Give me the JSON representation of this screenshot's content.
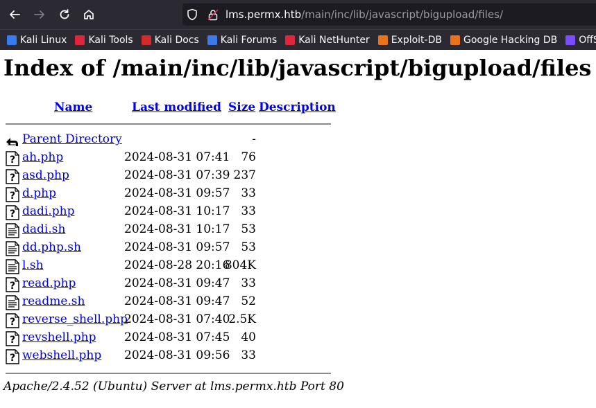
{
  "browser": {
    "url_host": "lms.permx.htb",
    "url_path": "/main/inc/lib/javascript/bigupload/files/",
    "nav_icons": [
      "back-arrow-icon",
      "forward-arrow-icon",
      "reload-icon",
      "home-icon"
    ],
    "bookmarks": [
      {
        "label": "Kali Linux",
        "color": "#367bf0"
      },
      {
        "label": "Kali Tools",
        "color": "#e0263b"
      },
      {
        "label": "Kali Docs",
        "color": "#d12b2b"
      },
      {
        "label": "Kali Forums",
        "color": "#3d7ae6"
      },
      {
        "label": "Kali NetHunter",
        "color": "#e0263b"
      },
      {
        "label": "Exploit-DB",
        "color": "#e8731a"
      },
      {
        "label": "Google Hacking DB",
        "color": "#e8731a"
      },
      {
        "label": "OffSec",
        "color": "#7c4dff"
      }
    ]
  },
  "page": {
    "title": "Index of /main/inc/lib/javascript/bigupload/files",
    "headers": {
      "name": "Name",
      "last_modified": "Last modified",
      "size": "Size",
      "description": "Description"
    },
    "parent": {
      "name": "Parent Directory",
      "size": "-"
    },
    "files": [
      {
        "name": "ah.php",
        "modified": "2024-08-31 07:41",
        "size": "76",
        "icon": "unknown-file-icon"
      },
      {
        "name": "asd.php",
        "modified": "2024-08-31 07:39",
        "size": "237",
        "icon": "unknown-file-icon"
      },
      {
        "name": "d.php",
        "modified": "2024-08-31 09:57",
        "size": "33",
        "icon": "unknown-file-icon"
      },
      {
        "name": "dadi.php",
        "modified": "2024-08-31 10:17",
        "size": "33",
        "icon": "unknown-file-icon"
      },
      {
        "name": "dadi.sh",
        "modified": "2024-08-31 10:17",
        "size": "53",
        "icon": "text-file-icon"
      },
      {
        "name": "dd.php.sh",
        "modified": "2024-08-31 09:57",
        "size": "53",
        "icon": "text-file-icon"
      },
      {
        "name": "l.sh",
        "modified": "2024-08-28 20:16",
        "size": "804K",
        "icon": "text-file-icon"
      },
      {
        "name": "read.php",
        "modified": "2024-08-31 09:47",
        "size": "33",
        "icon": "unknown-file-icon"
      },
      {
        "name": "readme.sh",
        "modified": "2024-08-31 09:47",
        "size": "52",
        "icon": "text-file-icon"
      },
      {
        "name": "reverse_shell.php",
        "modified": "2024-08-31 07:40",
        "size": "2.5K",
        "icon": "unknown-file-icon"
      },
      {
        "name": "revshell.php",
        "modified": "2024-08-31 07:45",
        "size": "40",
        "icon": "unknown-file-icon"
      },
      {
        "name": "webshell.php",
        "modified": "2024-08-31 09:56",
        "size": "33",
        "icon": "unknown-file-icon"
      }
    ],
    "footer": "Apache/2.4.52 (Ubuntu) Server at lms.permx.htb Port 80"
  }
}
